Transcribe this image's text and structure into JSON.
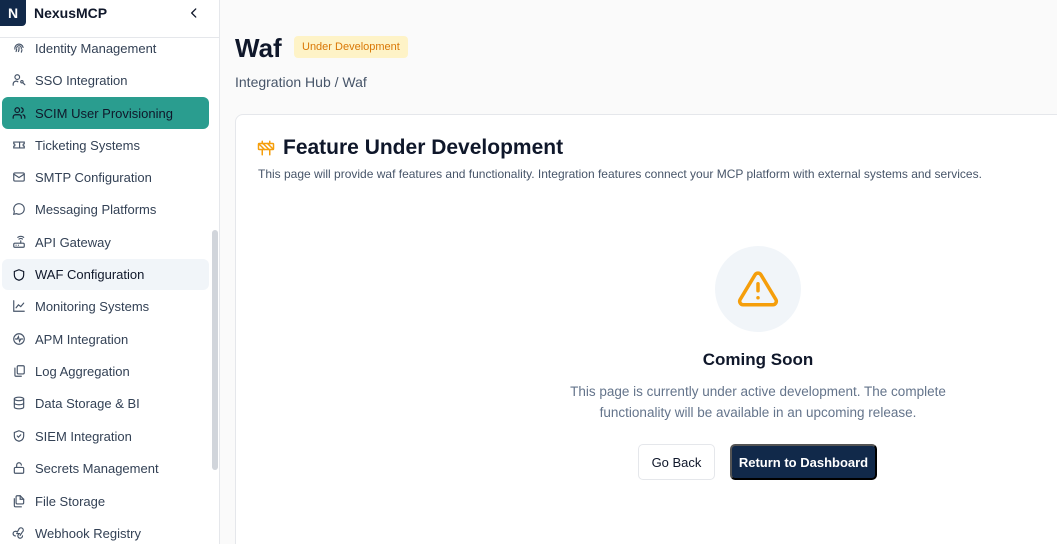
{
  "brand": {
    "logo_letter": "N",
    "name": "NexusMCP"
  },
  "sidebar": {
    "items": [
      {
        "label": "Identity Management",
        "icon": "fingerprint-icon"
      },
      {
        "label": "SSO Integration",
        "icon": "user-key-icon"
      },
      {
        "label": "SCIM User Provisioning",
        "icon": "users-icon",
        "state": "active"
      },
      {
        "label": "Ticketing Systems",
        "icon": "ticket-icon"
      },
      {
        "label": "SMTP Configuration",
        "icon": "mail-icon"
      },
      {
        "label": "Messaging Platforms",
        "icon": "message-circle-icon"
      },
      {
        "label": "API Gateway",
        "icon": "router-icon"
      },
      {
        "label": "WAF Configuration",
        "icon": "shield-icon",
        "state": "selected"
      },
      {
        "label": "Monitoring Systems",
        "icon": "line-chart-icon"
      },
      {
        "label": "APM Integration",
        "icon": "activity-circle-icon"
      },
      {
        "label": "Log Aggregation",
        "icon": "files-icon"
      },
      {
        "label": "Data Storage & BI",
        "icon": "database-icon"
      },
      {
        "label": "SIEM Integration",
        "icon": "shield-check-icon"
      },
      {
        "label": "Secrets Management",
        "icon": "lock-icon"
      },
      {
        "label": "File Storage",
        "icon": "file-stack-icon"
      },
      {
        "label": "Webhook Registry",
        "icon": "webhook-icon"
      }
    ]
  },
  "header": {
    "title": "Waf",
    "badge": "Under Development",
    "breadcrumb": "Integration Hub / Waf"
  },
  "card": {
    "title": "Feature Under Development",
    "description": "This page will provide waf features and functionality. Integration features connect your MCP platform with external systems and services.",
    "coming_title": "Coming Soon",
    "coming_text_line1": "This page is currently under active development. The complete",
    "coming_text_line2": "functionality will be available in an upcoming release.",
    "back_label": "Go Back",
    "dashboard_label": "Return to Dashboard"
  },
  "colors": {
    "accent_active": "#2a9d8f",
    "primary_navy": "#11294a",
    "warning": "#f59e0b",
    "badge_bg": "#fef3c7"
  }
}
